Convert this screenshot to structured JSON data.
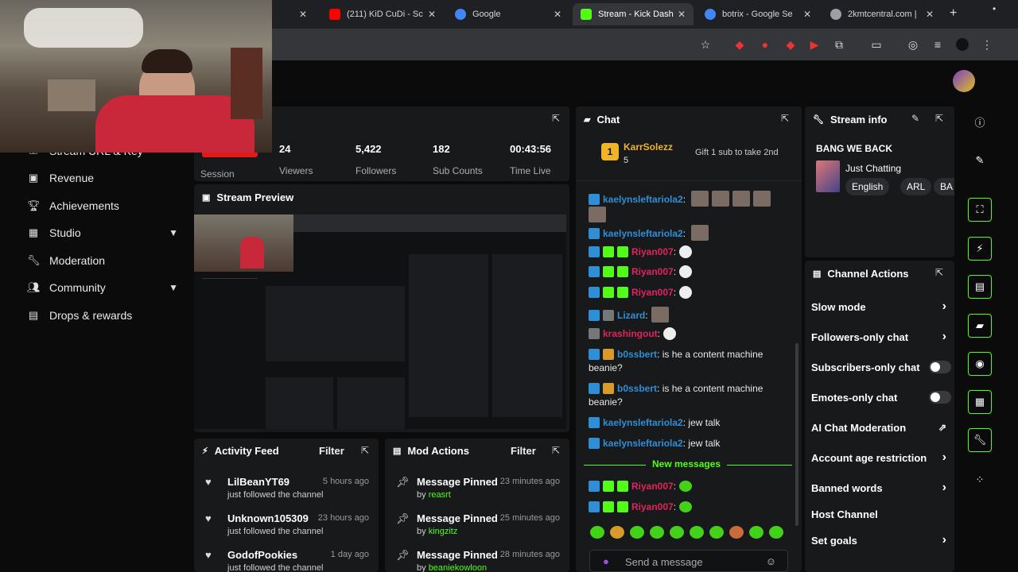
{
  "browser": {
    "tabs": [
      {
        "title": "(211) KiD CuDi - Sc",
        "favicon_color": "#ff0000"
      },
      {
        "title": "Google",
        "favicon_color": "#4285f4"
      },
      {
        "title": "Stream - Kick Dash",
        "favicon_color": "#53fc18"
      },
      {
        "title": "botrix - Google Se",
        "favicon_color": "#4285f4"
      },
      {
        "title": "2kmtcentral.com | ",
        "favicon_color": "#9aa0a6"
      }
    ],
    "new_tab": "+"
  },
  "sidebar": {
    "partial_item": "Stream URL & Key",
    "items": [
      {
        "label": "Revenue",
        "icon": "dollar-icon"
      },
      {
        "label": "Achievements",
        "icon": "trophy-icon"
      },
      {
        "label": "Studio",
        "icon": "studio-icon"
      },
      {
        "label": "Moderation",
        "icon": "wrench-icon"
      },
      {
        "label": "Community",
        "icon": "people-icon"
      },
      {
        "label": "Drops & rewards",
        "icon": "gift-icon"
      }
    ]
  },
  "session": {
    "status_badge": "STREAMING",
    "label": "Session",
    "stats": [
      {
        "value": "24",
        "label": "Viewers"
      },
      {
        "value": "5,422",
        "label": "Followers"
      },
      {
        "value": "182",
        "label": "Sub Counts"
      },
      {
        "value": "00:43:56",
        "label": "Time Live"
      }
    ]
  },
  "stream_preview": {
    "title": "Stream Preview"
  },
  "activity_feed": {
    "title": "Activity Feed",
    "filter": "Filter",
    "items": [
      {
        "name": "LilBeanYT69",
        "action": "just followed the channel",
        "time": "5 hours ago"
      },
      {
        "name": "Unknown105309",
        "action": "just followed the channel",
        "time": "23 hours ago"
      },
      {
        "name": "GodofPookies",
        "action": "just followed the channel",
        "time": "1 day ago"
      }
    ]
  },
  "mod_actions": {
    "title": "Mod Actions",
    "filter": "Filter",
    "items": [
      {
        "action": "Message Pinned",
        "by": "by",
        "user": "reasrt",
        "time": "23 minutes ago"
      },
      {
        "action": "Message Pinned",
        "by": "by",
        "user": "kingzitz",
        "time": "25 minutes ago"
      },
      {
        "action": "Message Pinned",
        "by": "by",
        "user": "beaniekowloon",
        "time": "28 minutes ago"
      }
    ]
  },
  "chat": {
    "title": "Chat",
    "pinned": {
      "rank": "1",
      "user": "KarrSolezz",
      "count": "5",
      "cta": "Gift 1 sub to take 2nd"
    },
    "messages": [
      {
        "user": "kaelynsleftariola2",
        "color": "#2f8fd6",
        "text": ""
      },
      {
        "user": "kaelynsleftariola2",
        "color": "#2f8fd6",
        "text": ""
      },
      {
        "user": "Riyan007",
        "color": "#e0245e",
        "text": ""
      },
      {
        "user": "Riyan007",
        "color": "#e0245e",
        "text": ""
      },
      {
        "user": "Riyan007",
        "color": "#e0245e",
        "text": ""
      },
      {
        "user": "Lizard",
        "color": "#2f8fd6",
        "text": ""
      },
      {
        "user": "krashingout",
        "color": "#e0245e",
        "text": ""
      },
      {
        "user": "b0ssbert",
        "color": "#2f8fd6",
        "text": "is he a content machine beanie?"
      },
      {
        "user": "b0ssbert",
        "color": "#2f8fd6",
        "text": "is he a content machine beanie?"
      },
      {
        "user": "kaelynsleftariola2",
        "color": "#2f8fd6",
        "text": "jew talk"
      },
      {
        "user": "kaelynsleftariola2",
        "color": "#2f8fd6",
        "text": "jew talk"
      },
      {
        "user": "Riyan007",
        "color": "#e0245e",
        "text": ""
      },
      {
        "user": "Riyan007",
        "color": "#e0245e",
        "text": ""
      }
    ],
    "new_messages": "New messages",
    "input_placeholder": "Send a message"
  },
  "stream_info": {
    "title": "Stream info",
    "stream_title": "BANG WE BACK",
    "category": "Just Chatting",
    "tags": [
      "English",
      "ARL",
      "BA"
    ]
  },
  "channel_actions": {
    "title": "Channel Actions",
    "items": [
      {
        "label": "Slow mode",
        "control": "arrow"
      },
      {
        "label": "Followers-only chat",
        "control": "arrow"
      },
      {
        "label": "Subscribers-only chat",
        "control": "toggle"
      },
      {
        "label": "Emotes-only chat",
        "control": "toggle"
      },
      {
        "label": "AI Chat Moderation",
        "control": "external"
      },
      {
        "label": "Account age restriction",
        "control": "arrow"
      },
      {
        "label": "Banned words",
        "control": "arrow"
      },
      {
        "label": "Host Channel",
        "control": "none"
      },
      {
        "label": "Set goals",
        "control": "arrow"
      }
    ]
  },
  "colors": {
    "accent": "#53fc18",
    "panel": "#18191b",
    "bg": "#0b0b0c"
  }
}
